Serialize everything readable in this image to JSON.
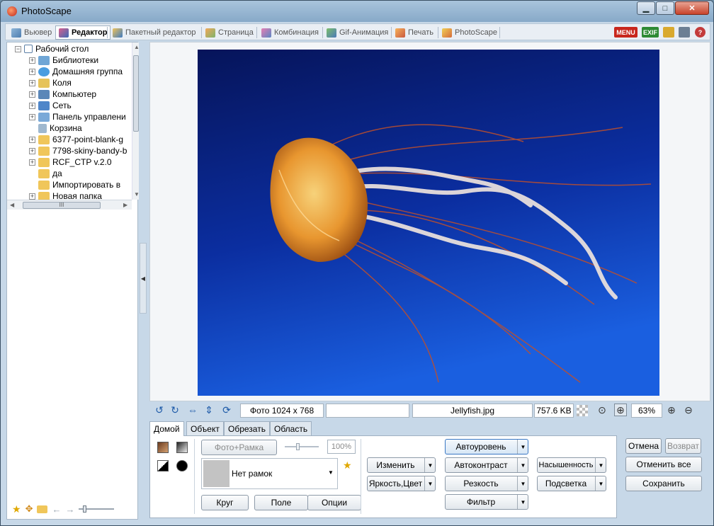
{
  "window": {
    "title": "PhotoScape",
    "min_glyph": "▁",
    "max_glyph": "□",
    "close_glyph": "✕"
  },
  "main_tabs": [
    {
      "label": "Вьювер"
    },
    {
      "label": "Редактор"
    },
    {
      "label": "Пакетный редактор"
    },
    {
      "label": "Страница"
    },
    {
      "label": "Комбинация"
    },
    {
      "label": "Gif-Анимация"
    },
    {
      "label": "Печать"
    },
    {
      "label": "PhotoScape"
    }
  ],
  "top_icons": {
    "menu": "MENU",
    "exif": "EXIF",
    "help": "?"
  },
  "tree": {
    "root": "Рабочий стол",
    "items": [
      {
        "label": "Библиотеки",
        "icon": "libraries-icon",
        "color": "#6fa6d6"
      },
      {
        "label": "Домашняя группа",
        "icon": "homegroup-icon",
        "color": "#4a9de0"
      },
      {
        "label": "Коля",
        "icon": "user-folder-icon",
        "color": "#e6c35a"
      },
      {
        "label": "Компьютер",
        "icon": "computer-icon",
        "color": "#5b87b8"
      },
      {
        "label": "Сеть",
        "icon": "network-icon",
        "color": "#4f86c9"
      },
      {
        "label": "Панель управлени",
        "icon": "control-panel-icon",
        "color": "#7aa9d8"
      },
      {
        "label": "Корзина",
        "icon": "recycle-bin-icon",
        "color": "#9fb8cf"
      },
      {
        "label": "6377-point-blank-g",
        "icon": "folder-icon",
        "color": "#f0c65a"
      },
      {
        "label": "7798-skiny-bandy-b",
        "icon": "folder-icon",
        "color": "#f0c65a"
      },
      {
        "label": "RCF_CTP v.2.0",
        "icon": "folder-icon",
        "color": "#f0c65a"
      },
      {
        "label": "да",
        "icon": "folder-icon",
        "color": "#f0c65a"
      },
      {
        "label": "Импортировать в",
        "icon": "folder-icon",
        "color": "#f0c65a"
      },
      {
        "label": "Новая папка",
        "icon": "folder-icon",
        "color": "#f0c65a"
      }
    ],
    "hscroll_label": "III"
  },
  "infobar": {
    "dimensions": "Фото 1024 x 768",
    "filename": "Jellyfish.jpg",
    "filesize": "757.6 KB",
    "zoom": "63%"
  },
  "subtabs": [
    {
      "label": "Домой"
    },
    {
      "label": "Объект"
    },
    {
      "label": "Обрезать"
    },
    {
      "label": "Область"
    }
  ],
  "home": {
    "photo_frame": "Фото+Рамка",
    "frame_percent": "100%",
    "frame_select": "Нет рамок",
    "circle": "Круг",
    "field": "Поле",
    "options": "Опции",
    "resize": "Изменить",
    "brightness_color": "Яркость,Цвет",
    "autolevel": "Автоуровень",
    "autocontrast": "Автоконтраст",
    "sharpen": "Резкость",
    "filter": "Фильтр",
    "saturation": "Насышенность",
    "backlight": "Подсветка"
  },
  "actions": {
    "undo": "Отмена",
    "redo": "Возврат",
    "undo_all": "Отменить все",
    "save": "Сохранить"
  },
  "colors": {
    "accent": "#3a6ea5",
    "photo_bg_top": "#06145a",
    "photo_bg_bottom": "#1a5fe0",
    "jelly": "#e8962f"
  }
}
